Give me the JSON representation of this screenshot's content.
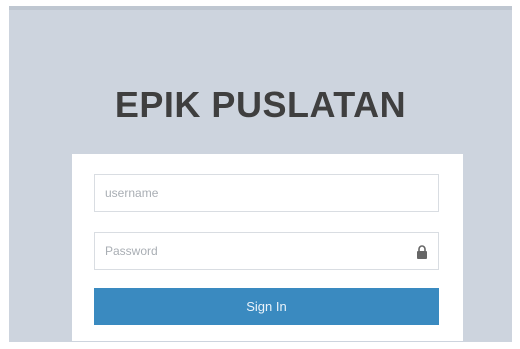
{
  "app": {
    "title": "EPIK PUSLATAN"
  },
  "login": {
    "username_placeholder": "username",
    "username_value": "",
    "password_placeholder": "Password",
    "password_value": "",
    "password_icon": "lock-icon",
    "signin_label": "Sign In"
  },
  "colors": {
    "background": "#cdd4de",
    "card": "#ffffff",
    "button": "#3a8ac0",
    "title": "#3f3f3f"
  }
}
